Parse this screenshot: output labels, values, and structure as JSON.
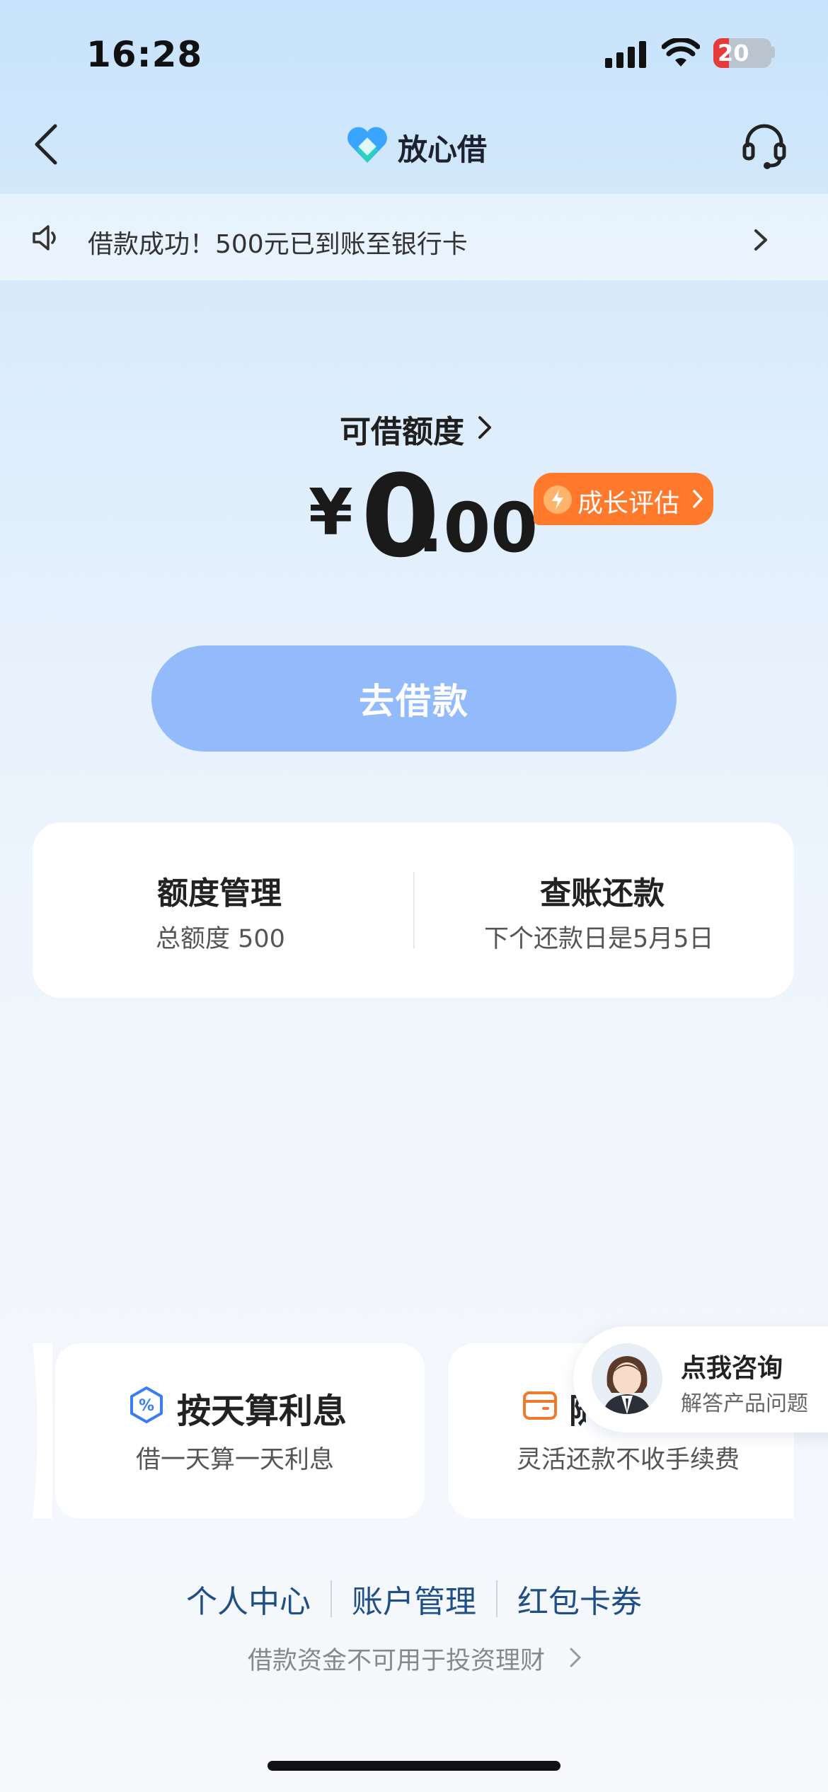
{
  "status_bar": {
    "time": "16:28",
    "battery": "20"
  },
  "nav": {
    "title": "放心借",
    "back_icon": "chevron-left-icon",
    "support_icon": "headset-icon"
  },
  "notice": {
    "text": "借款成功！500元已到账至银行卡"
  },
  "credit": {
    "label": "可借额度",
    "currency": "¥",
    "amount_integer": "0",
    "amount_decimal": ".00",
    "growth_badge": "成长评估",
    "borrow_button": "去借款"
  },
  "quick_actions": [
    {
      "title": "额度管理",
      "subtitle": "总额度 500"
    },
    {
      "title": "查账还款",
      "subtitle": "下个还款日是5月5日"
    }
  ],
  "features": [
    {
      "title": "按天算利息",
      "subtitle": "借一天算一天利息",
      "icon": "percent-shield-icon"
    },
    {
      "title": "随",
      "subtitle": "灵活还款不收手续费",
      "icon": "wallet-icon"
    }
  ],
  "consult": {
    "title": "点我咨询",
    "subtitle": "解答产品问题"
  },
  "footer": {
    "links": [
      "个人中心",
      "账户管理",
      "红包卡券"
    ],
    "disclaimer": "借款资金不可用于投资理财"
  },
  "colors": {
    "primary_button": "#93bbfb",
    "badge": "#ff7a2c",
    "link": "#1f4f86"
  }
}
